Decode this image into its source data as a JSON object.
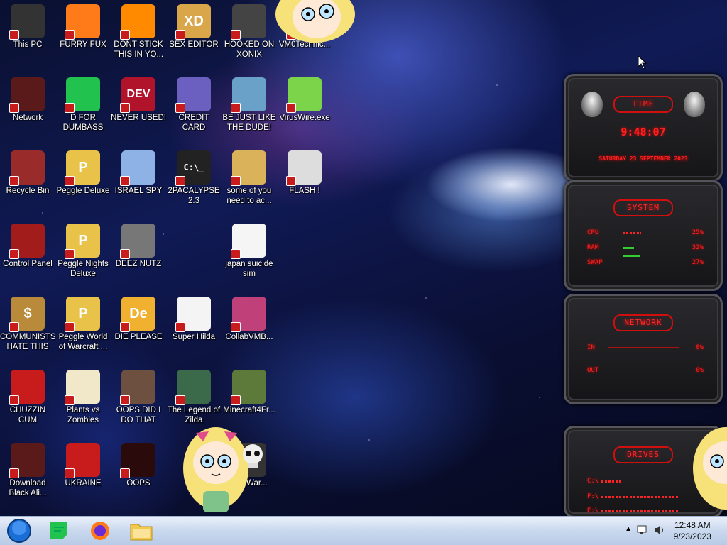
{
  "desktop": {
    "icons": [
      {
        "label": "This PC"
      },
      {
        "label": "FURRY FUX"
      },
      {
        "label": "DONT STICK THIS IN YO..."
      },
      {
        "label": "SEX EDITOR"
      },
      {
        "label": "HOOKED ON XONIX"
      },
      {
        "label": "VM0Technic..."
      },
      {
        "label": "Network"
      },
      {
        "label": "D FOR DUMBASS"
      },
      {
        "label": "NEVER USED!"
      },
      {
        "label": "CREDIT CARD CHECKER"
      },
      {
        "label": "BE JUST LIKE THE DUDE!"
      },
      {
        "label": "VirusWire.exe"
      },
      {
        "label": "Recycle Bin"
      },
      {
        "label": "Peggle Deluxe"
      },
      {
        "label": "ISRAEL SPY"
      },
      {
        "label": "2PACALYPSE 2.3"
      },
      {
        "label": "some of you need to ac..."
      },
      {
        "label": "FLASH !"
      },
      {
        "label": "Control Panel"
      },
      {
        "label": "Peggle Nights Deluxe"
      },
      {
        "label": "DEEZ NUTZ"
      },
      {
        "label": "japan suicide sim"
      },
      {
        "label": "COMMUNISTS HATE THIS G..."
      },
      {
        "label": "Peggle World of Warcraft ..."
      },
      {
        "label": "DIE PLEASE"
      },
      {
        "label": "Super Hilda"
      },
      {
        "label": "CollabVMB..."
      },
      {
        "label": "CHUZZIN CUM"
      },
      {
        "label": "Plants vs Zombies"
      },
      {
        "label": "OOPS DID I DO THAT"
      },
      {
        "label": "The Legend of Zilda"
      },
      {
        "label": "Minecraft4Fr..."
      },
      {
        "label": "Download Black Ali..."
      },
      {
        "label": "UKRAINE"
      },
      {
        "label": "OOPS"
      },
      {
        "label": "somWar..."
      }
    ],
    "icon_glyphs": {
      "dev": "DEV",
      "de": "De",
      "cmd": "C:\\_",
      "p": "P",
      "xd": "XD",
      "money": "$"
    }
  },
  "widgets": {
    "time": {
      "title": "TIME",
      "clock": "9:48:07",
      "date": "SATURDAY 23 SEPTEMBER 2023"
    },
    "system": {
      "title": "SYSTEM",
      "rows": [
        {
          "label": "CPU",
          "value": "25%"
        },
        {
          "label": "RAM",
          "value": "32%"
        },
        {
          "label": "SWAP",
          "value": "27%"
        }
      ]
    },
    "network": {
      "title": "NETWORK",
      "rows": [
        {
          "label": "IN",
          "value": "0%"
        },
        {
          "label": "OUT",
          "value": "0%"
        }
      ]
    },
    "drives": {
      "title": "DRIVES",
      "rows": [
        {
          "label": "C:\\"
        },
        {
          "label": "F:\\"
        },
        {
          "label": "E:\\"
        }
      ]
    }
  },
  "taskbar": {
    "time": "12:48 AM",
    "date": "9/23/2023"
  },
  "colors": {
    "widget_red": "#ff2020",
    "taskbar": "#c9d8ee"
  }
}
